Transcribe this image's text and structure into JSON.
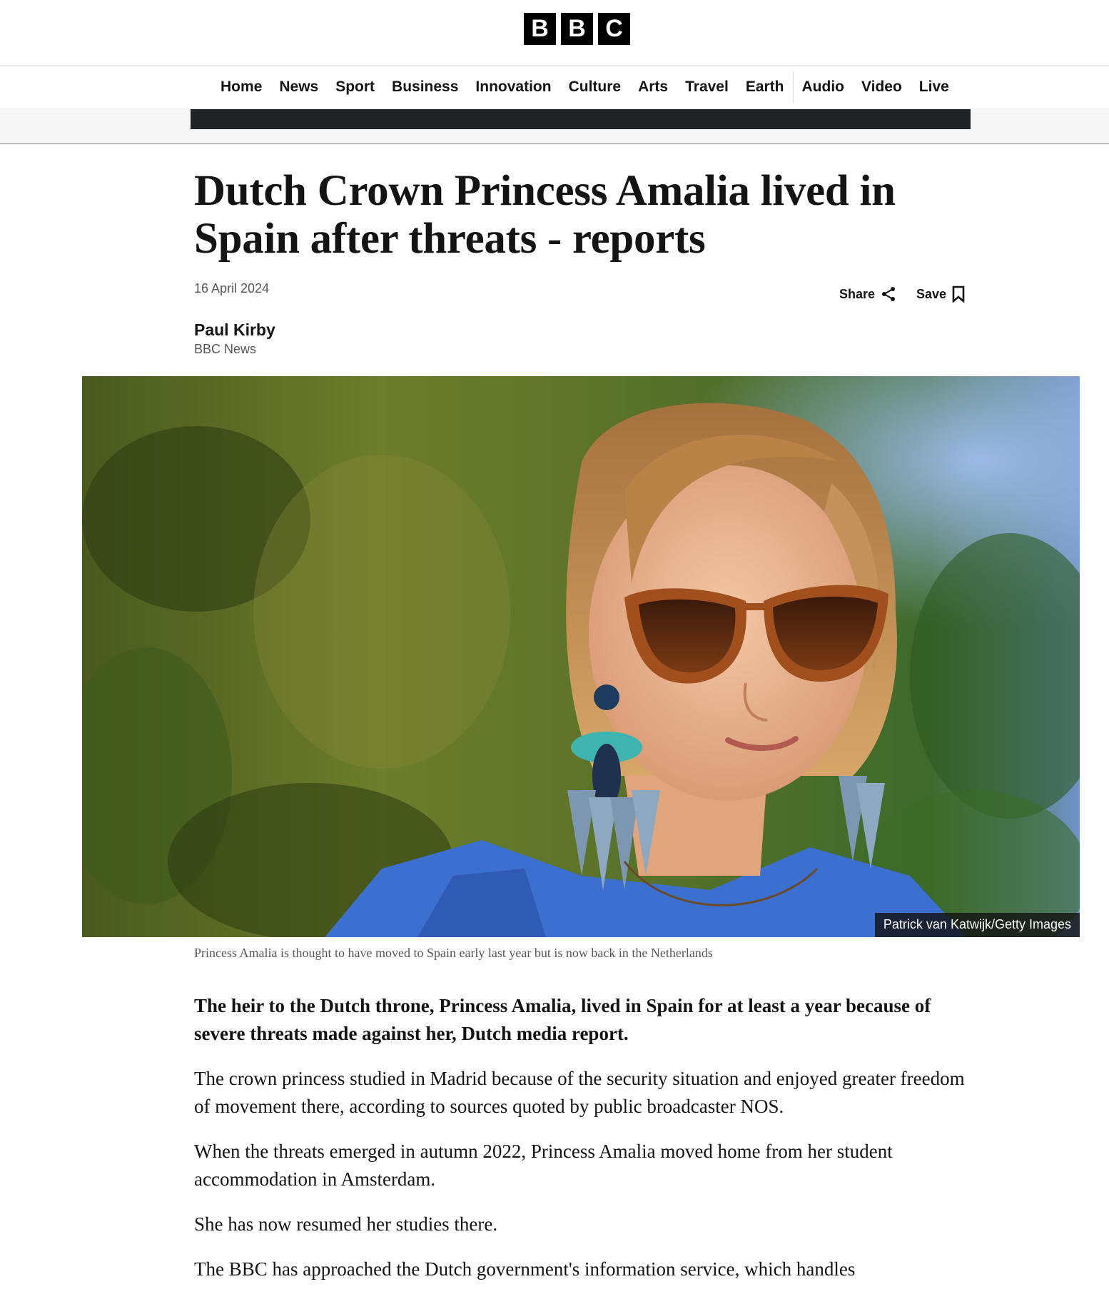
{
  "masthead": {
    "logo_letters": [
      "B",
      "B",
      "C"
    ]
  },
  "nav": {
    "items_primary": [
      "Home",
      "News",
      "Sport",
      "Business",
      "Innovation",
      "Culture",
      "Arts",
      "Travel",
      "Earth"
    ],
    "items_secondary": [
      "Audio",
      "Video",
      "Live"
    ]
  },
  "article": {
    "headline": "Dutch Crown Princess Amalia lived in Spain after threats - reports",
    "date": "16 April 2024",
    "share_label": "Share",
    "save_label": "Save",
    "author": "Paul Kirby",
    "author_org": "BBC News",
    "image_credit": "Patrick van Katwijk/Getty Images",
    "image_caption": "Princess Amalia is thought to have moved to Spain early last year but is now back in the Netherlands",
    "paragraphs": [
      "The heir to the Dutch throne, Princess Amalia, lived in Spain for at least a year because of severe threats made against her, Dutch media report.",
      "The crown princess studied in Madrid because of the security situation and enjoyed greater freedom of movement there, according to sources quoted by public broadcaster NOS.",
      "When the threats emerged in autumn 2022, Princess Amalia moved home from her student accommodation in Amsterdam.",
      "She has now resumed her studies there.",
      "The BBC has approached the Dutch government's information service, which handles"
    ]
  }
}
